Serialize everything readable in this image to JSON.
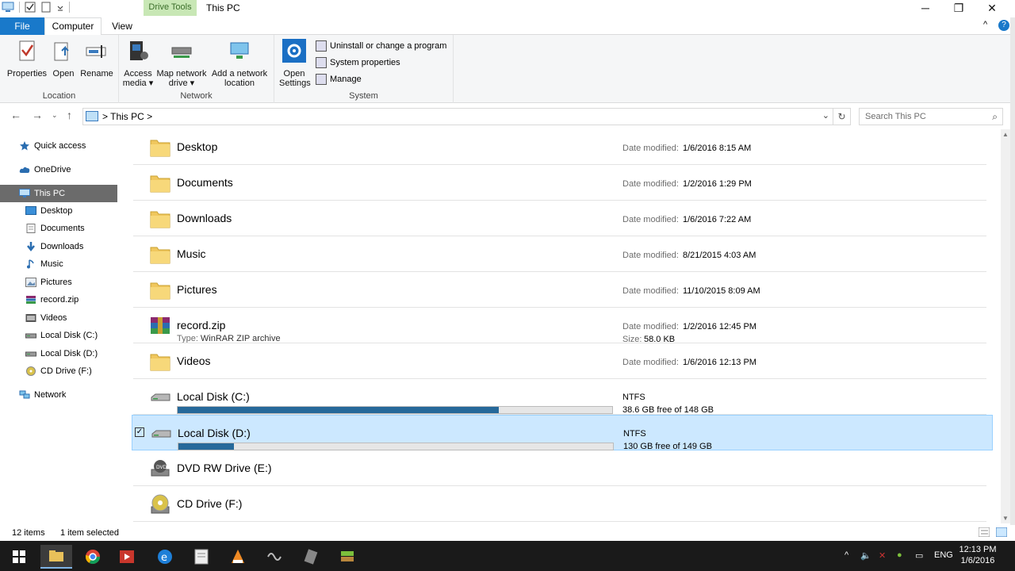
{
  "window": {
    "title": "This PC",
    "contextual_tab": "Drive Tools",
    "minimize_glyph": "─",
    "restore_glyph": "❐",
    "close_glyph": "✕"
  },
  "ribbon_tabs": {
    "file": "File",
    "computer": "Computer",
    "view": "View",
    "collapse_glyph": "^",
    "help_glyph": "?"
  },
  "ribbon": {
    "location": {
      "label": "Location",
      "properties": "Properties",
      "open": "Open",
      "rename": "Rename"
    },
    "network": {
      "label": "Network",
      "access_media_1": "Access",
      "access_media_2": "media ▾",
      "map_drive_1": "Map network",
      "map_drive_2": "drive ▾",
      "add_location_1": "Add a network",
      "add_location_2": "location"
    },
    "system": {
      "label": "System",
      "open_settings_1": "Open",
      "open_settings_2": "Settings",
      "uninstall": "Uninstall or change a program",
      "system_properties": "System properties",
      "manage": "Manage"
    }
  },
  "address": {
    "crumb": "> This PC >",
    "search_placeholder": "Search This PC"
  },
  "nav": [
    {
      "label": "Quick access",
      "icon": "star-icon",
      "indent": 0
    },
    {
      "label": "OneDrive",
      "icon": "cloud-icon",
      "indent": 0
    },
    {
      "label": "This PC",
      "icon": "computer-icon",
      "indent": 0,
      "selected": true
    },
    {
      "label": "Desktop",
      "icon": "desktop-icon",
      "indent": 1
    },
    {
      "label": "Documents",
      "icon": "documents-icon",
      "indent": 1
    },
    {
      "label": "Downloads",
      "icon": "downloads-icon",
      "indent": 1
    },
    {
      "label": "Music",
      "icon": "music-icon",
      "indent": 1
    },
    {
      "label": "Pictures",
      "icon": "pictures-icon",
      "indent": 1
    },
    {
      "label": "record.zip",
      "icon": "zip-icon",
      "indent": 1
    },
    {
      "label": "Videos",
      "icon": "videos-icon",
      "indent": 1
    },
    {
      "label": "Local Disk (C:)",
      "icon": "disk-icon",
      "indent": 1
    },
    {
      "label": "Local Disk (D:)",
      "icon": "disk-icon",
      "indent": 1
    },
    {
      "label": "CD Drive (F:)",
      "icon": "cd-icon",
      "indent": 1
    },
    {
      "label": "Network",
      "icon": "network-icon",
      "indent": 0
    }
  ],
  "items": [
    {
      "name": "Desktop",
      "kind": "folder",
      "date_label": "Date modified:",
      "date": "1/6/2016 8:15 AM"
    },
    {
      "name": "Documents",
      "kind": "folder",
      "date_label": "Date modified:",
      "date": "1/2/2016 1:29 PM"
    },
    {
      "name": "Downloads",
      "kind": "folder",
      "date_label": "Date modified:",
      "date": "1/6/2016 7:22 AM"
    },
    {
      "name": "Music",
      "kind": "folder",
      "date_label": "Date modified:",
      "date": "8/21/2015 4:03 AM"
    },
    {
      "name": "Pictures",
      "kind": "folder",
      "date_label": "Date modified:",
      "date": "11/10/2015 8:09 AM"
    },
    {
      "name": "record.zip",
      "kind": "zip",
      "type_label": "Type:",
      "type": "WinRAR ZIP archive",
      "date_label": "Date modified:",
      "date": "1/2/2016 12:45 PM",
      "size_label": "Size:",
      "size": "58.0 KB"
    },
    {
      "name": "Videos",
      "kind": "folder",
      "date_label": "Date modified:",
      "date": "1/6/2016 12:13 PM"
    },
    {
      "name": "Local Disk (C:)",
      "kind": "disk",
      "fs": "NTFS",
      "free": "38.6 GB free of 148 GB",
      "used_fraction": 0.739
    },
    {
      "name": "Local Disk (D:)",
      "kind": "disk",
      "fs": "NTFS",
      "free": "130 GB free of 149 GB",
      "used_fraction": 0.128,
      "selected": true
    },
    {
      "name": "DVD RW Drive (E:)",
      "kind": "dvd"
    },
    {
      "name": "CD Drive (F:)",
      "kind": "cd"
    }
  ],
  "status": {
    "count": "12 items",
    "selected": "1 item selected"
  },
  "taskbar": {
    "lang": "ENG",
    "time": "12:13 PM",
    "date": "1/6/2016"
  },
  "colors": {
    "accent": "#1979ca",
    "drive_tools": "#c8e7b5",
    "selection": "#cce8ff",
    "disk_bar": "#26699a"
  }
}
